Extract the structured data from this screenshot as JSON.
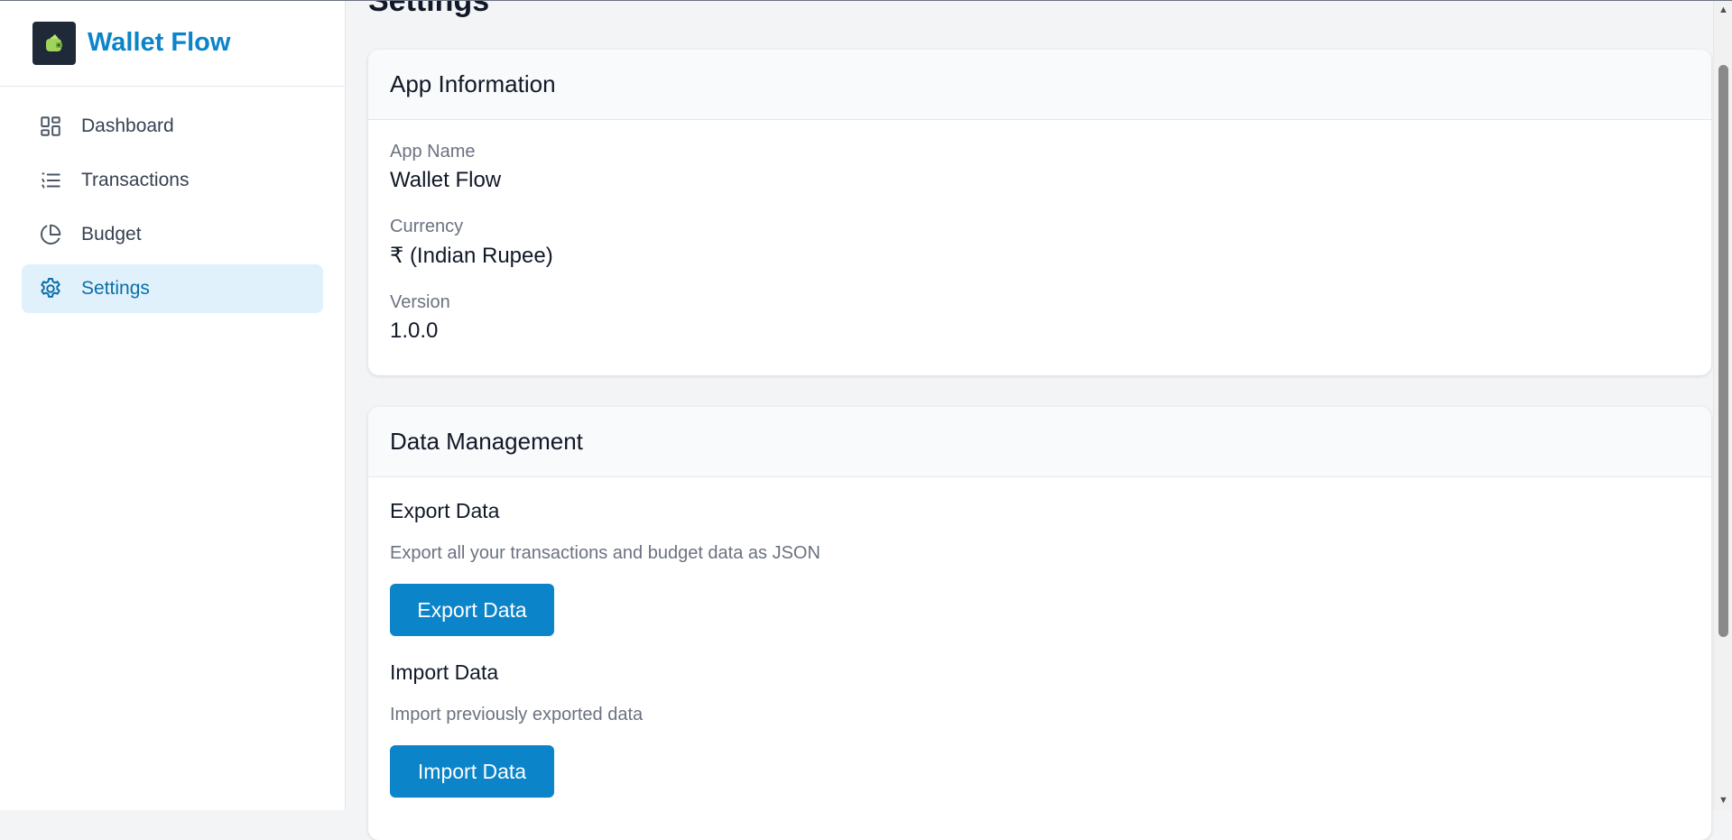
{
  "app": {
    "name": "Wallet Flow",
    "logo_icon": "wallet-icon",
    "brand_color": "#0b84c9"
  },
  "sidebar": {
    "items": [
      {
        "label": "Dashboard",
        "icon": "dashboard-grid-icon",
        "active": false
      },
      {
        "label": "Transactions",
        "icon": "list-icon",
        "active": false
      },
      {
        "label": "Budget",
        "icon": "pie-chart-icon",
        "active": false
      },
      {
        "label": "Settings",
        "icon": "gear-icon",
        "active": true
      }
    ]
  },
  "page": {
    "title": "Settings"
  },
  "app_info": {
    "title": "App Information",
    "fields": [
      {
        "label": "App Name",
        "value": "Wallet Flow"
      },
      {
        "label": "Currency",
        "value": "₹ (Indian Rupee)"
      },
      {
        "label": "Version",
        "value": "1.0.0"
      }
    ]
  },
  "data_management": {
    "title": "Data Management",
    "export": {
      "title": "Export Data",
      "description": "Export all your transactions and budget data as JSON",
      "button": "Export Data"
    },
    "import": {
      "title": "Import Data",
      "description": "Import previously exported data",
      "button": "Import Data"
    }
  }
}
